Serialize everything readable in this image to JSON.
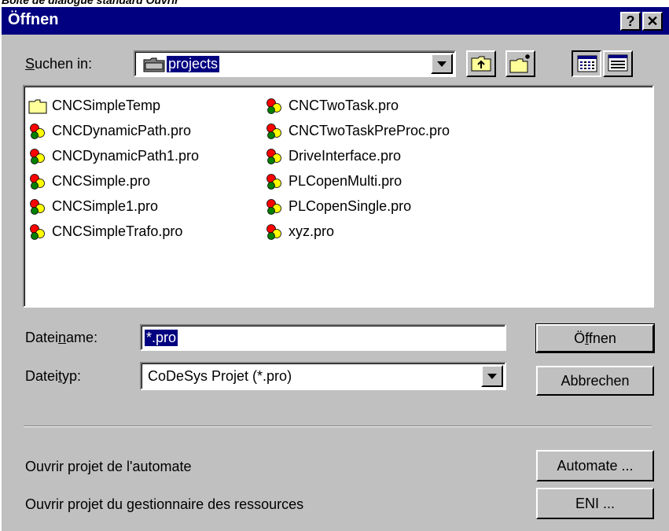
{
  "caption": "Boîte de dialogue standard Ouvrir",
  "window": {
    "title": "Öffnen",
    "help_btn": "?",
    "close_btn": "✕"
  },
  "lookin": {
    "label_pre": "",
    "label_ul": "S",
    "label_post": "uchen in:",
    "value": "projects"
  },
  "toolbar": {
    "up_icon": "up-folder-icon",
    "newfolder_icon": "new-folder-icon",
    "list_icon": "list-view-icon",
    "details_icon": "details-view-icon"
  },
  "files": [
    {
      "name": "CNCSimpleTemp",
      "type": "folder"
    },
    {
      "name": "CNCDynamicPath.pro",
      "type": "project"
    },
    {
      "name": "CNCDynamicPath1.pro",
      "type": "project"
    },
    {
      "name": "CNCSimple.pro",
      "type": "project"
    },
    {
      "name": "CNCSimple1.pro",
      "type": "project"
    },
    {
      "name": "CNCSimpleTrafo.pro",
      "type": "project"
    },
    {
      "name": "CNCTwoTask.pro",
      "type": "project"
    },
    {
      "name": "CNCTwoTaskPreProc.pro",
      "type": "project"
    },
    {
      "name": "DriveInterface.pro",
      "type": "project"
    },
    {
      "name": "PLCopenMulti.pro",
      "type": "project"
    },
    {
      "name": "PLCopenSingle.pro",
      "type": "project"
    },
    {
      "name": "xyz.pro",
      "type": "project"
    }
  ],
  "filename": {
    "label_pre": "Datei",
    "label_ul": "n",
    "label_post": "ame:",
    "value": "*.pro"
  },
  "filetype": {
    "label_pre": "Datei",
    "label_ul": "t",
    "label_post": "yp:",
    "value": "CoDeSys Projet (*.pro)"
  },
  "buttons": {
    "open_pre": "Ö",
    "open_ul": "f",
    "open_post": "fnen",
    "cancel": "Abbrechen",
    "automate": "Automate ...",
    "eni": "ENI ..."
  },
  "extra": {
    "plc_label": "Ouvrir projet de l'automate",
    "eni_label": "Ouvrir projet du gestionnaire des ressources"
  },
  "colors": {
    "titlebar": "#000080",
    "dialog_bg": "#c0c0c0",
    "selection": "#000080"
  }
}
